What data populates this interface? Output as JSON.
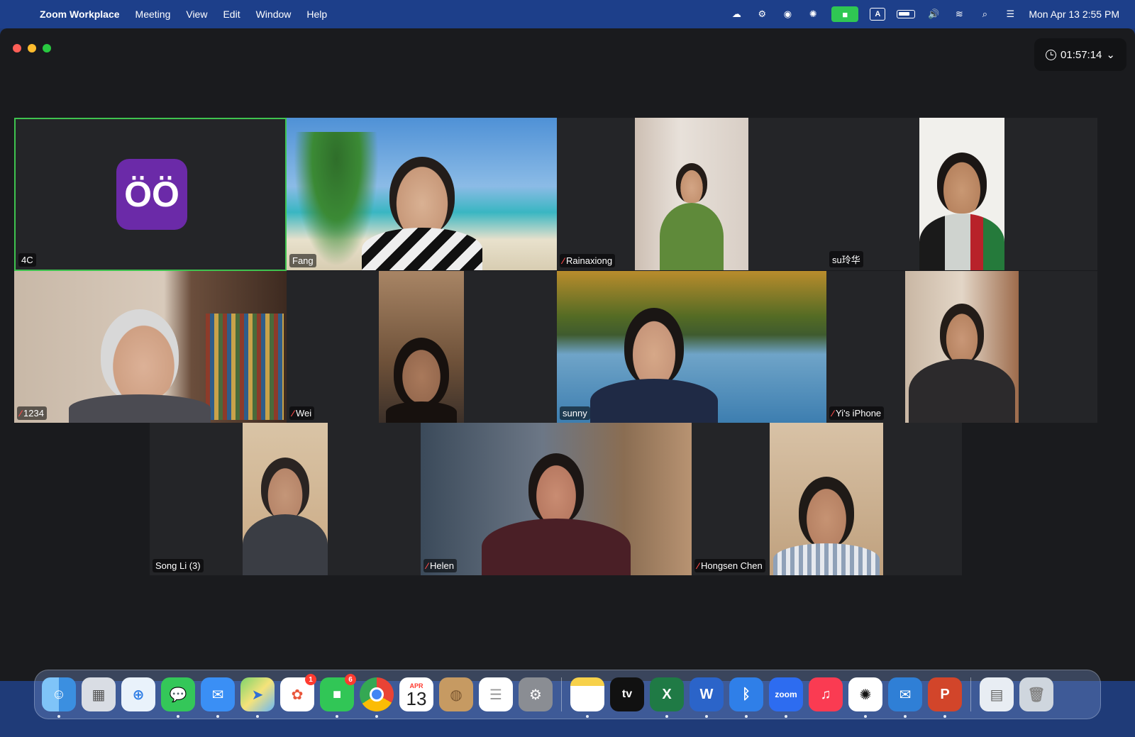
{
  "menubar": {
    "app_name": "Zoom Workplace",
    "items": [
      "Meeting",
      "View",
      "Edit",
      "Window",
      "Help"
    ],
    "input_source": "A",
    "clock": "Mon Apr 13  2:55 PM"
  },
  "window": {
    "timer": "01:57:14"
  },
  "participants": [
    {
      "name": "4C",
      "muted": false,
      "active": true,
      "avatar": "4C-logo"
    },
    {
      "name": "Fang",
      "muted": false
    },
    {
      "name": "Rainaxiong",
      "muted": true
    },
    {
      "name": "su玲华",
      "muted": false
    },
    {
      "name": "1234",
      "muted": true
    },
    {
      "name": "Wei",
      "muted": true
    },
    {
      "name": "sunny",
      "muted": false
    },
    {
      "name": "Yi's iPhone",
      "muted": true
    },
    {
      "name": "Song Li (3)",
      "muted": false
    },
    {
      "name": "Helen",
      "muted": true
    },
    {
      "name": "Hongsen Chen",
      "muted": true
    }
  ],
  "dock": {
    "apps": [
      {
        "name": "Finder",
        "icon": "finder-icon"
      },
      {
        "name": "Launchpad",
        "icon": "launchpad-icon"
      },
      {
        "name": "Safari",
        "icon": "safari-icon"
      },
      {
        "name": "Messages",
        "icon": "messages-icon"
      },
      {
        "name": "Mail",
        "icon": "mail-icon"
      },
      {
        "name": "Maps",
        "icon": "maps-icon"
      },
      {
        "name": "Photos",
        "icon": "photos-icon",
        "badge": "1"
      },
      {
        "name": "FaceTime",
        "icon": "facetime-icon",
        "badge": "6"
      },
      {
        "name": "Chrome",
        "icon": "chrome-icon"
      },
      {
        "name": "Calendar",
        "icon": "calendar-icon",
        "month": "APR",
        "day": "13"
      },
      {
        "name": "Contacts",
        "icon": "contacts-icon"
      },
      {
        "name": "Reminders",
        "icon": "reminders-icon"
      },
      {
        "name": "System Settings",
        "icon": "settings-icon"
      },
      {
        "name": "Notes",
        "icon": "notes-icon"
      },
      {
        "name": "Apple TV",
        "icon": "appletv-icon",
        "label": "tv"
      },
      {
        "name": "Excel",
        "icon": "excel-icon",
        "label": "X"
      },
      {
        "name": "Word",
        "icon": "word-icon",
        "label": "W"
      },
      {
        "name": "Bluetooth",
        "icon": "bluetooth-icon"
      },
      {
        "name": "Zoom",
        "icon": "zoom-icon",
        "label": "zoom"
      },
      {
        "name": "Music",
        "icon": "music-icon"
      },
      {
        "name": "ChatGPT",
        "icon": "chatgpt-icon"
      },
      {
        "name": "Outlook",
        "icon": "outlook-icon"
      },
      {
        "name": "PowerPoint",
        "icon": "powerpoint-icon",
        "label": "P"
      },
      {
        "name": "Downloads",
        "icon": "downloads-icon"
      },
      {
        "name": "Trash",
        "icon": "trash-icon"
      }
    ]
  },
  "colors": {
    "active_speaker_border": "#3fc34f",
    "muted_icon": "#ff4a4a",
    "window_bg": "#1a1b1e"
  }
}
